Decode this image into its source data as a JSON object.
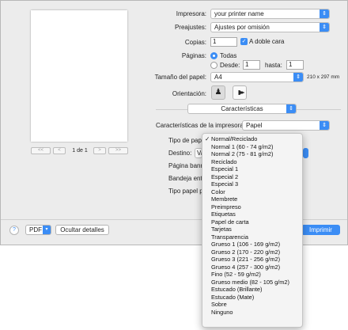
{
  "printer": {
    "label": "Impresora:",
    "value": "your printer name"
  },
  "presets": {
    "label": "Preajustes:",
    "value": "Ajustes por omisión"
  },
  "copies": {
    "label": "Copias:",
    "value": "1",
    "duplex_label": "A doble cara",
    "duplex_checked": true
  },
  "pages": {
    "label": "Páginas:",
    "all_label": "Todas",
    "from_label": "Desde:",
    "from_value": "1",
    "to_label": "hasta:",
    "to_value": "1"
  },
  "paper_size": {
    "label": "Tamaño del papel:",
    "value": "A4",
    "dimensions": "210 x 297 mm"
  },
  "orientation": {
    "label": "Orientación:"
  },
  "section": {
    "value": "Características"
  },
  "printer_features": {
    "label": "Características de la impresora:",
    "value": "Papel"
  },
  "hidden_fields": {
    "paper_type_label": "Tipo de papel",
    "destination_label": "Destino:",
    "destination_value": "Va",
    "banner_label": "Página banne",
    "tray_label": "Bandeja entra",
    "paper_type2_label": "Tipo papel pá"
  },
  "preview_nav": {
    "first": "<<",
    "prev": "<",
    "page": "1 de 1",
    "next": ">",
    "last": ">>"
  },
  "footer": {
    "help": "?",
    "pdf": "PDF",
    "hide_details": "Ocultar detalles",
    "print": "Imprimir"
  },
  "paper_type_menu": {
    "selected": "Normal/Reciclado",
    "items": [
      "Normal/Reciclado",
      "Normal 1 (60 - 74 g/m2)",
      "Normal 2 (75 - 81 g/m2)",
      "Reciclado",
      "Especial 1",
      "Especial 2",
      "Especial 3",
      "Color",
      "Membrete",
      "Preimpreso",
      "Etiquetas",
      "Papel de carta",
      "Tarjetas",
      "Transparencia",
      "Grueso 1 (106 - 169 g/m2)",
      "Grueso 2 (170 - 220 g/m2)",
      "Grueso 3 (221 - 256 g/m2)",
      "Grueso 4 (257 - 300 g/m2)",
      "Fino (52 - 59 g/m2)",
      "Grueso medio (82 - 105 g/m2)",
      "Estucado (Brillante)",
      "Estucado (Mate)",
      "Sobre",
      "Ninguno"
    ]
  },
  "colors": {
    "accent": "#3b8df5",
    "dialog_bg": "#ececec"
  }
}
